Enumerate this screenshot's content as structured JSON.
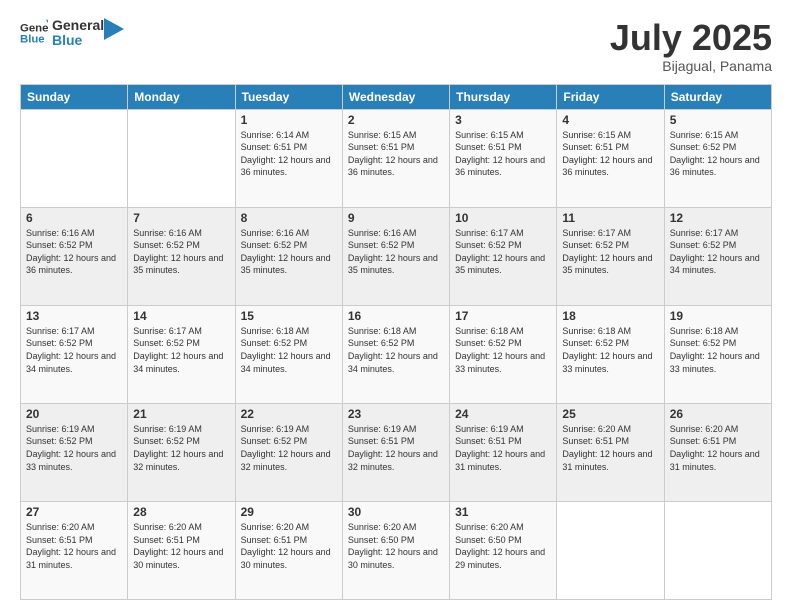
{
  "logo": {
    "text_general": "General",
    "text_blue": "Blue"
  },
  "header": {
    "title": "July 2025",
    "subtitle": "Bijagual, Panama"
  },
  "weekdays": [
    "Sunday",
    "Monday",
    "Tuesday",
    "Wednesday",
    "Thursday",
    "Friday",
    "Saturday"
  ],
  "weeks": [
    [
      {
        "day": "",
        "sunrise": "",
        "sunset": "",
        "daylight": ""
      },
      {
        "day": "",
        "sunrise": "",
        "sunset": "",
        "daylight": ""
      },
      {
        "day": "1",
        "sunrise": "Sunrise: 6:14 AM",
        "sunset": "Sunset: 6:51 PM",
        "daylight": "Daylight: 12 hours and 36 minutes."
      },
      {
        "day": "2",
        "sunrise": "Sunrise: 6:15 AM",
        "sunset": "Sunset: 6:51 PM",
        "daylight": "Daylight: 12 hours and 36 minutes."
      },
      {
        "day": "3",
        "sunrise": "Sunrise: 6:15 AM",
        "sunset": "Sunset: 6:51 PM",
        "daylight": "Daylight: 12 hours and 36 minutes."
      },
      {
        "day": "4",
        "sunrise": "Sunrise: 6:15 AM",
        "sunset": "Sunset: 6:51 PM",
        "daylight": "Daylight: 12 hours and 36 minutes."
      },
      {
        "day": "5",
        "sunrise": "Sunrise: 6:15 AM",
        "sunset": "Sunset: 6:52 PM",
        "daylight": "Daylight: 12 hours and 36 minutes."
      }
    ],
    [
      {
        "day": "6",
        "sunrise": "Sunrise: 6:16 AM",
        "sunset": "Sunset: 6:52 PM",
        "daylight": "Daylight: 12 hours and 36 minutes."
      },
      {
        "day": "7",
        "sunrise": "Sunrise: 6:16 AM",
        "sunset": "Sunset: 6:52 PM",
        "daylight": "Daylight: 12 hours and 35 minutes."
      },
      {
        "day": "8",
        "sunrise": "Sunrise: 6:16 AM",
        "sunset": "Sunset: 6:52 PM",
        "daylight": "Daylight: 12 hours and 35 minutes."
      },
      {
        "day": "9",
        "sunrise": "Sunrise: 6:16 AM",
        "sunset": "Sunset: 6:52 PM",
        "daylight": "Daylight: 12 hours and 35 minutes."
      },
      {
        "day": "10",
        "sunrise": "Sunrise: 6:17 AM",
        "sunset": "Sunset: 6:52 PM",
        "daylight": "Daylight: 12 hours and 35 minutes."
      },
      {
        "day": "11",
        "sunrise": "Sunrise: 6:17 AM",
        "sunset": "Sunset: 6:52 PM",
        "daylight": "Daylight: 12 hours and 35 minutes."
      },
      {
        "day": "12",
        "sunrise": "Sunrise: 6:17 AM",
        "sunset": "Sunset: 6:52 PM",
        "daylight": "Daylight: 12 hours and 34 minutes."
      }
    ],
    [
      {
        "day": "13",
        "sunrise": "Sunrise: 6:17 AM",
        "sunset": "Sunset: 6:52 PM",
        "daylight": "Daylight: 12 hours and 34 minutes."
      },
      {
        "day": "14",
        "sunrise": "Sunrise: 6:17 AM",
        "sunset": "Sunset: 6:52 PM",
        "daylight": "Daylight: 12 hours and 34 minutes."
      },
      {
        "day": "15",
        "sunrise": "Sunrise: 6:18 AM",
        "sunset": "Sunset: 6:52 PM",
        "daylight": "Daylight: 12 hours and 34 minutes."
      },
      {
        "day": "16",
        "sunrise": "Sunrise: 6:18 AM",
        "sunset": "Sunset: 6:52 PM",
        "daylight": "Daylight: 12 hours and 34 minutes."
      },
      {
        "day": "17",
        "sunrise": "Sunrise: 6:18 AM",
        "sunset": "Sunset: 6:52 PM",
        "daylight": "Daylight: 12 hours and 33 minutes."
      },
      {
        "day": "18",
        "sunrise": "Sunrise: 6:18 AM",
        "sunset": "Sunset: 6:52 PM",
        "daylight": "Daylight: 12 hours and 33 minutes."
      },
      {
        "day": "19",
        "sunrise": "Sunrise: 6:18 AM",
        "sunset": "Sunset: 6:52 PM",
        "daylight": "Daylight: 12 hours and 33 minutes."
      }
    ],
    [
      {
        "day": "20",
        "sunrise": "Sunrise: 6:19 AM",
        "sunset": "Sunset: 6:52 PM",
        "daylight": "Daylight: 12 hours and 33 minutes."
      },
      {
        "day": "21",
        "sunrise": "Sunrise: 6:19 AM",
        "sunset": "Sunset: 6:52 PM",
        "daylight": "Daylight: 12 hours and 32 minutes."
      },
      {
        "day": "22",
        "sunrise": "Sunrise: 6:19 AM",
        "sunset": "Sunset: 6:52 PM",
        "daylight": "Daylight: 12 hours and 32 minutes."
      },
      {
        "day": "23",
        "sunrise": "Sunrise: 6:19 AM",
        "sunset": "Sunset: 6:51 PM",
        "daylight": "Daylight: 12 hours and 32 minutes."
      },
      {
        "day": "24",
        "sunrise": "Sunrise: 6:19 AM",
        "sunset": "Sunset: 6:51 PM",
        "daylight": "Daylight: 12 hours and 31 minutes."
      },
      {
        "day": "25",
        "sunrise": "Sunrise: 6:20 AM",
        "sunset": "Sunset: 6:51 PM",
        "daylight": "Daylight: 12 hours and 31 minutes."
      },
      {
        "day": "26",
        "sunrise": "Sunrise: 6:20 AM",
        "sunset": "Sunset: 6:51 PM",
        "daylight": "Daylight: 12 hours and 31 minutes."
      }
    ],
    [
      {
        "day": "27",
        "sunrise": "Sunrise: 6:20 AM",
        "sunset": "Sunset: 6:51 PM",
        "daylight": "Daylight: 12 hours and 31 minutes."
      },
      {
        "day": "28",
        "sunrise": "Sunrise: 6:20 AM",
        "sunset": "Sunset: 6:51 PM",
        "daylight": "Daylight: 12 hours and 30 minutes."
      },
      {
        "day": "29",
        "sunrise": "Sunrise: 6:20 AM",
        "sunset": "Sunset: 6:51 PM",
        "daylight": "Daylight: 12 hours and 30 minutes."
      },
      {
        "day": "30",
        "sunrise": "Sunrise: 6:20 AM",
        "sunset": "Sunset: 6:50 PM",
        "daylight": "Daylight: 12 hours and 30 minutes."
      },
      {
        "day": "31",
        "sunrise": "Sunrise: 6:20 AM",
        "sunset": "Sunset: 6:50 PM",
        "daylight": "Daylight: 12 hours and 29 minutes."
      },
      {
        "day": "",
        "sunrise": "",
        "sunset": "",
        "daylight": ""
      },
      {
        "day": "",
        "sunrise": "",
        "sunset": "",
        "daylight": ""
      }
    ]
  ]
}
